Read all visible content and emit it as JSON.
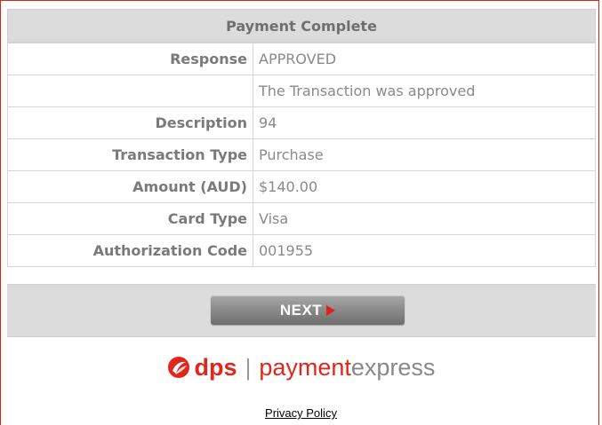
{
  "header": {
    "title": "Payment Complete"
  },
  "details": {
    "rows": [
      {
        "label": "Response",
        "value": "APPROVED"
      },
      {
        "label": "",
        "value": "The Transaction was approved"
      },
      {
        "label": "Description",
        "value": "94"
      },
      {
        "label": "Transaction Type",
        "value": "Purchase"
      },
      {
        "label": "Amount (AUD)",
        "value": "$140.00"
      },
      {
        "label": "Card Type",
        "value": "Visa"
      },
      {
        "label": "Authorization Code",
        "value": "001955"
      }
    ]
  },
  "actions": {
    "next_label": "NEXT",
    "next_icon": "play-arrow-icon"
  },
  "footer": {
    "logo": {
      "dps": "dps",
      "separator": "|",
      "payment": "payment",
      "express": "express",
      "icon": "dps-swirl-logo-icon"
    },
    "privacy_link": "Privacy Policy"
  },
  "colors": {
    "brand_red": "#e1261c",
    "header_bg": "#dcdcdc",
    "text_gray": "#8a8a8a"
  }
}
